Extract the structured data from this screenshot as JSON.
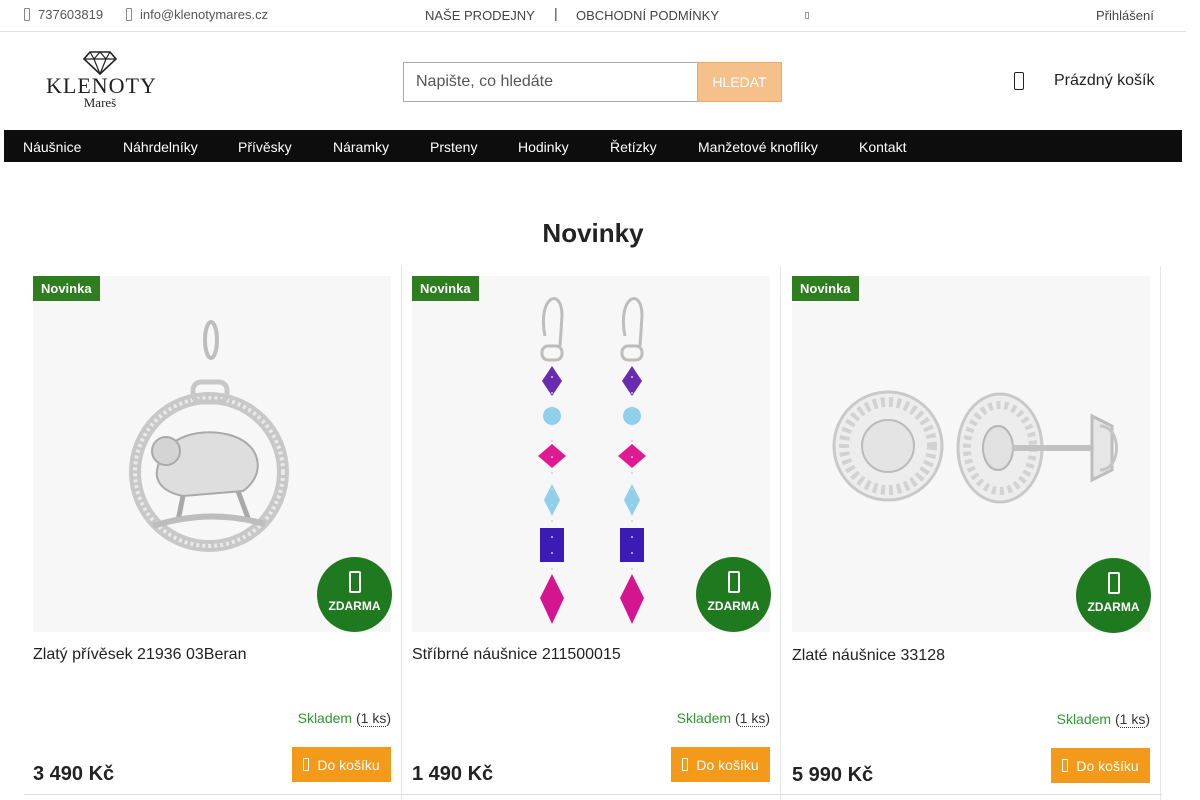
{
  "topbar": {
    "phone": "737603819",
    "email": "info@klenotymares.cz",
    "links": [
      "NAŠE PRODEJNY",
      "OBCHODNÍ PODMÍNKY"
    ],
    "separator": "|",
    "login": "Přihlášení"
  },
  "logo": {
    "name": "KLENOTY",
    "sub": "Mareš"
  },
  "search": {
    "placeholder": "Napište, co hledáte",
    "button": "HLEDAT"
  },
  "cart": {
    "label": "Prázdný košík"
  },
  "nav": {
    "items": [
      "Náušnice",
      "Náhrdelníky",
      "Přívěsky",
      "Náramky",
      "Prsteny",
      "Hodinky",
      "Řetízky",
      "Manžetové knoflíky",
      "Kontakt"
    ]
  },
  "section": {
    "title": "Novinky"
  },
  "products": [
    {
      "badge": "Novinka",
      "free_label": "ZDARMA",
      "title": "Zlatý přívěsek 21936 03Beran",
      "stock_label": "Skladem",
      "stock_qty": "1 ks",
      "price": "3 490 Kč",
      "buy_label": "Do košíku"
    },
    {
      "badge": "Novinka",
      "free_label": "ZDARMA",
      "title": "Stříbrné náušnice 211500015",
      "stock_label": "Skladem",
      "stock_qty": "1 ks",
      "price": "1 490 Kč",
      "buy_label": "Do košíku"
    },
    {
      "badge": "Novinka",
      "free_label": "ZDARMA",
      "title": "Zlaté náušnice 33128",
      "stock_label": "Skladem",
      "stock_qty": "1 ks",
      "price": "5 990 Kč",
      "buy_label": "Do košíku"
    }
  ],
  "colors": {
    "nav_bg": "#0d0d0d",
    "badge_green": "#2e7d1f",
    "free_circle": "#1f7a1f",
    "buy_orange": "#f39a1b",
    "search_button": "#f6c08a",
    "stock_green": "#2e9a2e"
  },
  "icons": {
    "phone": "phone-icon",
    "email": "envelope-icon",
    "cart": "shopping-bag-icon",
    "gift": "gift-icon",
    "buy": "cart-icon"
  }
}
